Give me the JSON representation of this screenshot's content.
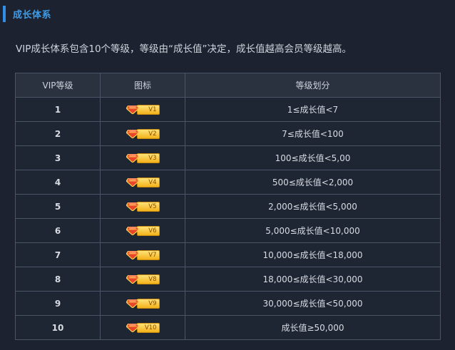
{
  "section": {
    "title": "成长体系"
  },
  "intro": "VIP成长体系包含10个等级，等级由“成长值”决定，成长值越高会员等级越高。",
  "table": {
    "headers": [
      "VIP等级",
      "图标",
      "等级划分"
    ],
    "rows": [
      {
        "level": "1",
        "badge": "V1",
        "range": "1≤成长值<7"
      },
      {
        "level": "2",
        "badge": "V2",
        "range": "7≤成长值<100"
      },
      {
        "level": "3",
        "badge": "V3",
        "range": "100≤成长值<5,00"
      },
      {
        "level": "4",
        "badge": "V4",
        "range": "500≤成长值<2,000"
      },
      {
        "level": "5",
        "badge": "V5",
        "range": "2,000≤成长值<5,000"
      },
      {
        "level": "6",
        "badge": "V6",
        "range": "5,000≤成长值<10,000"
      },
      {
        "level": "7",
        "badge": "V7",
        "range": "10,000≤成长值<18,000"
      },
      {
        "level": "8",
        "badge": "V8",
        "range": "18,000≤成长值<30,000"
      },
      {
        "level": "9",
        "badge": "V9",
        "range": "30,000≤成长值<50,000"
      },
      {
        "level": "10",
        "badge": "V10",
        "range": "成长值≥50,000"
      }
    ]
  },
  "colors": {
    "background": "#1c2230",
    "accent": "#2f8fe6",
    "title": "#3d9be8",
    "border": "#4a5568",
    "badge_gold": "#f2b21a",
    "gem_red": "#e8452a"
  },
  "icons": {
    "badge_gem": "diamond-gem-icon"
  }
}
